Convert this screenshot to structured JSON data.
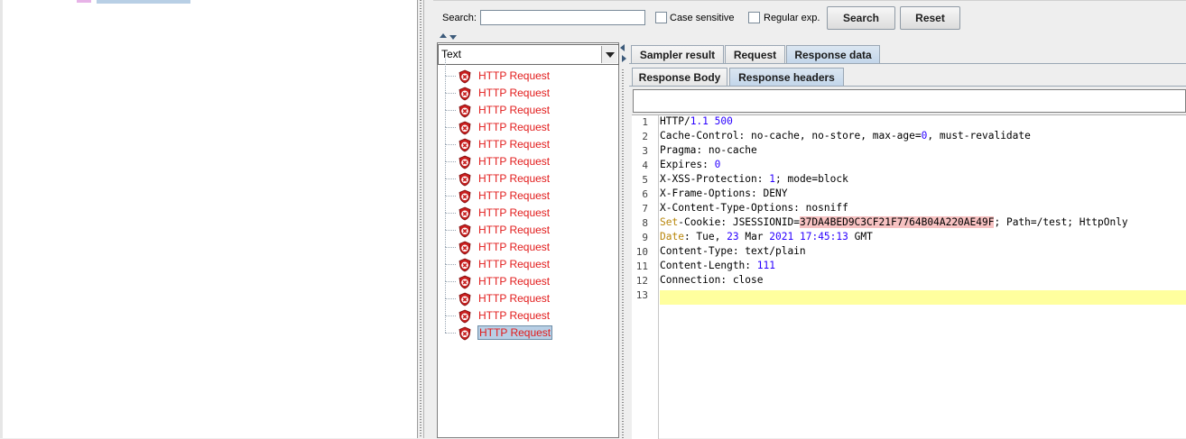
{
  "search": {
    "label": "Search:",
    "value": "",
    "case_sensitive_label": "Case sensitive",
    "regex_label": "Regular exp.",
    "search_button": "Search",
    "reset_button": "Reset"
  },
  "renderer_combo": {
    "selected": "Text"
  },
  "results": {
    "items": [
      {
        "label": "HTTP Request"
      },
      {
        "label": "HTTP Request"
      },
      {
        "label": "HTTP Request"
      },
      {
        "label": "HTTP Request"
      },
      {
        "label": "HTTP Request"
      },
      {
        "label": "HTTP Request"
      },
      {
        "label": "HTTP Request"
      },
      {
        "label": "HTTP Request"
      },
      {
        "label": "HTTP Request"
      },
      {
        "label": "HTTP Request"
      },
      {
        "label": "HTTP Request"
      },
      {
        "label": "HTTP Request"
      },
      {
        "label": "HTTP Request"
      },
      {
        "label": "HTTP Request"
      },
      {
        "label": "HTTP Request"
      },
      {
        "label": "HTTP Request"
      }
    ],
    "selected_index": 15,
    "item_status": "error",
    "status_color": "#e21b1b"
  },
  "tabs": {
    "main": [
      "Sampler result",
      "Request",
      "Response data"
    ],
    "main_active": "Response data",
    "sub": [
      "Response Body",
      "Response headers"
    ],
    "sub_active": "Response headers"
  },
  "response": {
    "line_numbers": [
      "1",
      "2",
      "3",
      "4",
      "5",
      "6",
      "7",
      "8",
      "9",
      "10",
      "11",
      "12",
      "13"
    ],
    "lines": [
      "HTTP/1.1 500",
      "Cache-Control: no-cache, no-store, max-age=0, must-revalidate",
      "Pragma: no-cache",
      "Expires: 0",
      "X-XSS-Protection: 1; mode=block",
      "X-Frame-Options: DENY",
      "X-Content-Type-Options: nosniff",
      "Set-Cookie: JSESSIONID=37DA4BED9C3CF21F7764B04A220AE49F; Path=/test; HttpOnly",
      "Date: Tue, 23 Mar 2021 17:45:13 GMT",
      "Content-Type: text/plain",
      "Content-Length: 111",
      "Connection: close",
      ""
    ],
    "current_line": 13
  },
  "colors": {
    "accent_selection": "#b8cfe5",
    "error_text": "#e21b1b",
    "number_highlight": "#2a00ff",
    "keyword_highlight": "#b8860b",
    "current_line": "#ffff9e"
  }
}
